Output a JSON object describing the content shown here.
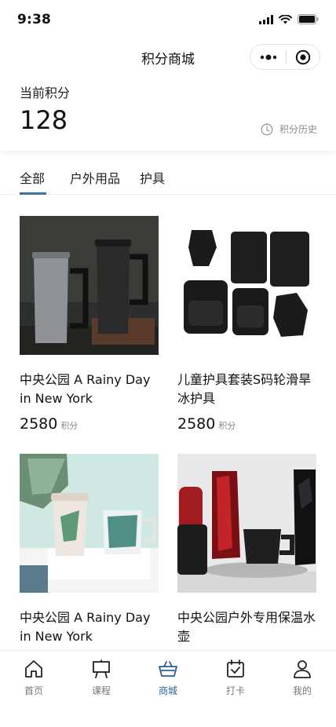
{
  "status_bar": {
    "time": "9:38"
  },
  "nav": {
    "title": "积分商城"
  },
  "points": {
    "label": "当前积分",
    "value": "128",
    "history_label": "积分历史"
  },
  "tabs": [
    {
      "label": "全部",
      "active": true
    },
    {
      "label": "户外用品",
      "active": false
    },
    {
      "label": "护具",
      "active": false
    }
  ],
  "products": [
    {
      "name": "中央公园 A Rainy Day in New York",
      "price": "2580",
      "unit": "积分"
    },
    {
      "name": "儿童护具套装S码轮滑旱冰护具",
      "price": "2580",
      "unit": "积分"
    },
    {
      "name": "中央公园 A Rainy Day in New York",
      "price": "",
      "unit": ""
    },
    {
      "name": "中央公园户外专用保温水壶",
      "price": "",
      "unit": ""
    }
  ],
  "tabbar": [
    {
      "label": "首页",
      "icon": "home-icon",
      "active": false
    },
    {
      "label": "课程",
      "icon": "easel-icon",
      "active": false
    },
    {
      "label": "商城",
      "icon": "basket-icon",
      "active": true
    },
    {
      "label": "打卡",
      "icon": "calendar-check-icon",
      "active": false
    },
    {
      "label": "我的",
      "icon": "user-icon",
      "active": false
    }
  ],
  "colors": {
    "accent": "#2f5f95",
    "tab_indicator": "#3a6fa8",
    "muted_text": "#888888"
  }
}
